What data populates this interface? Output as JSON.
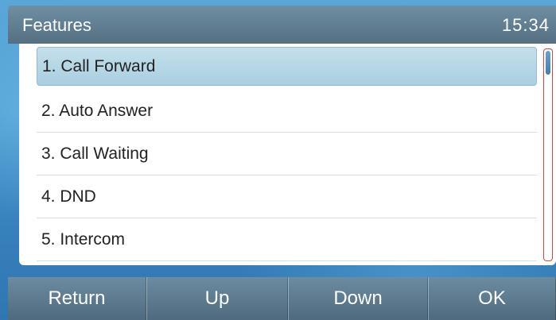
{
  "header": {
    "title": "Features",
    "clock": "15:34"
  },
  "menu": {
    "items": [
      {
        "label": "1. Call Forward",
        "selected": true
      },
      {
        "label": "2. Auto Answer",
        "selected": false
      },
      {
        "label": "3. Call Waiting",
        "selected": false
      },
      {
        "label": "4. DND",
        "selected": false
      },
      {
        "label": "5. Intercom",
        "selected": false
      }
    ]
  },
  "softkeys": {
    "return_label": "Return",
    "up_label": "Up",
    "down_label": "Down",
    "ok_label": "OK"
  },
  "colors": {
    "selection": "#a9cfe0",
    "scrollbar_border": "#d9443a",
    "title_bar": "#556f82"
  }
}
